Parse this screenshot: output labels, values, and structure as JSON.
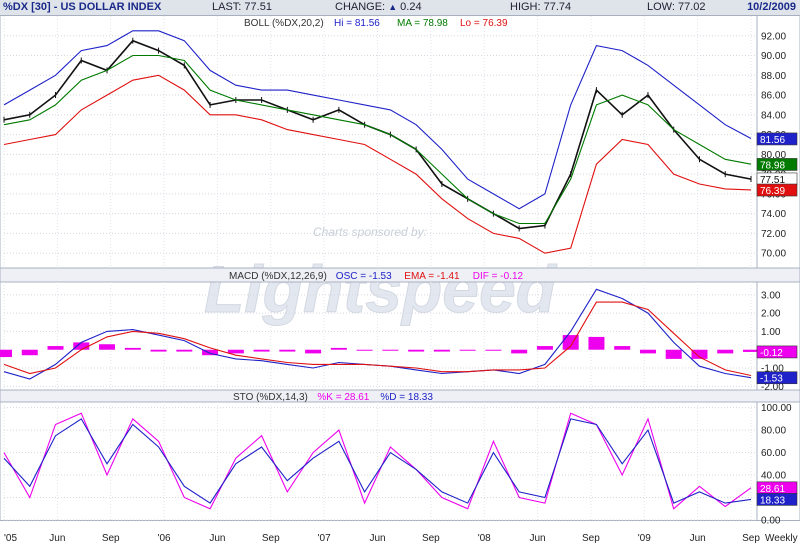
{
  "header": {
    "title": "%DX [30] - US DOLLAR INDEX",
    "last": "77.51",
    "change": "0.24",
    "high": "77.74",
    "low": "77.02",
    "date": "10/2/2009"
  },
  "watermark": {
    "sponsor": "Charts sponsored by:",
    "brand": "Lightspeed"
  },
  "colors": {
    "blue": "#1f22c8",
    "green": "#007a00",
    "red": "#e01010",
    "magenta": "#ee00ee",
    "price": "#111111"
  },
  "chart_data": [
    {
      "type": "line",
      "panel": "price",
      "title": "BOLL (%DX,20,2)",
      "legend": [
        {
          "label": "Hi = 81.56",
          "color": "#1f22c8"
        },
        {
          "label": "MA = 78.98",
          "color": "#007a00"
        },
        {
          "label": "Lo = 76.39",
          "color": "#e01010"
        }
      ],
      "ylim": [
        68.5,
        94
      ],
      "yticks": [
        "92.00",
        "90.00",
        "88.00",
        "86.00",
        "84.00",
        "82.00",
        "80.00",
        "78.00",
        "76.00",
        "74.00",
        "72.00",
        "70.00"
      ],
      "value_boxes": [
        {
          "label": "81.56",
          "value": 81.56,
          "color": "#1f22c8"
        },
        {
          "label": "78.98",
          "value": 78.98,
          "color": "#007a00"
        },
        {
          "label": "77.51",
          "value": 77.51,
          "color": "#ffffff"
        },
        {
          "label": "76.39",
          "value": 76.39,
          "color": "#e01010"
        }
      ],
      "x": [
        "2005-01",
        "2005-03",
        "2005-05",
        "2005-07",
        "2005-09",
        "2005-11",
        "2006-01",
        "2006-03",
        "2006-05",
        "2006-07",
        "2006-09",
        "2006-11",
        "2007-01",
        "2007-03",
        "2007-05",
        "2007-07",
        "2007-09",
        "2007-11",
        "2008-01",
        "2008-03",
        "2008-05",
        "2008-07",
        "2008-09",
        "2008-11",
        "2009-01",
        "2009-03",
        "2009-05",
        "2009-07",
        "2009-09",
        "2009-10"
      ],
      "series": [
        {
          "role": "price",
          "values": [
            83.5,
            84.0,
            86.0,
            89.5,
            88.5,
            91.5,
            90.5,
            89.0,
            85.0,
            85.5,
            85.5,
            84.5,
            83.5,
            84.5,
            83.0,
            82.0,
            80.5,
            77.0,
            75.5,
            74.0,
            72.5,
            72.8,
            78.0,
            86.5,
            84.0,
            86.0,
            82.5,
            79.5,
            78.0,
            77.5
          ]
        },
        {
          "role": "upper",
          "values": [
            85.0,
            86.5,
            88.0,
            90.5,
            91.0,
            92.5,
            92.5,
            91.5,
            88.5,
            87.0,
            86.5,
            86.5,
            86.0,
            85.5,
            85.0,
            84.5,
            83.0,
            80.5,
            77.5,
            76.0,
            74.5,
            76.0,
            85.0,
            91.0,
            90.5,
            89.0,
            87.0,
            85.0,
            83.0,
            81.6
          ]
        },
        {
          "role": "ma",
          "values": [
            83.0,
            83.5,
            85.0,
            87.5,
            88.5,
            90.0,
            90.0,
            89.5,
            86.5,
            85.5,
            85.0,
            84.5,
            84.0,
            83.5,
            83.0,
            82.0,
            80.5,
            78.0,
            75.5,
            74.0,
            73.0,
            73.0,
            77.5,
            85.0,
            86.0,
            85.0,
            82.5,
            81.0,
            79.5,
            79.0
          ]
        },
        {
          "role": "lower",
          "values": [
            81.0,
            81.5,
            82.0,
            84.5,
            86.0,
            87.5,
            88.0,
            86.5,
            84.0,
            84.0,
            83.5,
            82.5,
            82.0,
            81.5,
            81.0,
            79.5,
            78.0,
            75.5,
            73.5,
            72.0,
            71.5,
            70.0,
            70.5,
            79.0,
            81.5,
            81.0,
            78.0,
            77.0,
            76.5,
            76.4
          ]
        }
      ]
    },
    {
      "type": "line",
      "panel": "macd",
      "title": "MACD (%DX,12,26,9)",
      "legend": [
        {
          "label": "OSC = -1.53",
          "color": "#1f22c8"
        },
        {
          "label": "EMA = -1.41",
          "color": "#e01010"
        },
        {
          "label": "DIF = -0.12",
          "color": "#ee00ee"
        }
      ],
      "ylim": [
        -2.2,
        3.7
      ],
      "yticks": [
        "3.00",
        "2.00",
        "1.00",
        "-1.00",
        "-2.00"
      ],
      "value_boxes": [
        {
          "label": "-0.12",
          "value": -0.12,
          "color": "#ee00ee"
        },
        {
          "label": "-1.53",
          "value": -1.53,
          "color": "#1f22c8"
        }
      ],
      "series": [
        {
          "role": "osc",
          "values": [
            -1.2,
            -1.6,
            -0.8,
            0.4,
            1.0,
            1.1,
            0.8,
            0.5,
            -0.2,
            -0.5,
            -0.6,
            -0.8,
            -1.0,
            -0.7,
            -0.8,
            -0.9,
            -1.1,
            -1.3,
            -1.2,
            -1.1,
            -1.3,
            -0.8,
            1.0,
            3.3,
            2.8,
            2.0,
            0.4,
            -0.9,
            -1.3,
            -1.53
          ]
        },
        {
          "role": "ema",
          "values": [
            -0.8,
            -1.3,
            -1.0,
            0.0,
            0.7,
            1.0,
            0.9,
            0.6,
            0.1,
            -0.3,
            -0.5,
            -0.7,
            -0.8,
            -0.8,
            -0.8,
            -0.9,
            -1.0,
            -1.2,
            -1.2,
            -1.1,
            -1.1,
            -1.0,
            0.2,
            2.6,
            2.6,
            2.2,
            0.9,
            -0.4,
            -1.1,
            -1.41
          ]
        },
        {
          "role": "dif",
          "values": [
            -0.4,
            -0.3,
            0.2,
            0.4,
            0.3,
            0.1,
            -0.1,
            -0.1,
            -0.3,
            -0.2,
            -0.1,
            -0.1,
            -0.2,
            0.1,
            0.0,
            0.0,
            -0.1,
            -0.1,
            0.0,
            0.0,
            -0.2,
            0.2,
            0.8,
            0.7,
            0.2,
            -0.2,
            -0.5,
            -0.5,
            -0.2,
            -0.12
          ]
        }
      ]
    },
    {
      "type": "line",
      "panel": "sto",
      "title": "STO (%DX,14,3)",
      "legend": [
        {
          "label": "%K = 28.61",
          "color": "#ee00ee"
        },
        {
          "label": "%D = 18.33",
          "color": "#1f22c8"
        }
      ],
      "ylim": [
        0,
        105
      ],
      "yticks": [
        "100.00",
        "80.00",
        "60.00",
        "40.00",
        "20.00",
        "0.00"
      ],
      "value_boxes": [
        {
          "label": "28.61",
          "value": 28.61,
          "color": "#ee00ee"
        },
        {
          "label": "18.33",
          "value": 18.33,
          "color": "#1f22c8"
        }
      ],
      "series": [
        {
          "role": "k",
          "values": [
            60,
            20,
            85,
            95,
            40,
            90,
            70,
            20,
            10,
            55,
            75,
            25,
            60,
            80,
            15,
            65,
            45,
            20,
            10,
            70,
            20,
            15,
            95,
            85,
            40,
            90,
            10,
            30,
            12,
            28.61
          ]
        },
        {
          "role": "d",
          "values": [
            55,
            30,
            75,
            90,
            50,
            85,
            65,
            30,
            15,
            50,
            65,
            35,
            55,
            70,
            25,
            60,
            45,
            25,
            15,
            60,
            25,
            20,
            90,
            85,
            50,
            80,
            15,
            25,
            15,
            18.33
          ]
        }
      ]
    }
  ],
  "x_axis": {
    "ticks": [
      "'05",
      "Jun",
      "Sep",
      "'06",
      "Jun",
      "Sep",
      "'07",
      "Jun",
      "Sep",
      "'08",
      "Jun",
      "Sep",
      "'09",
      "Jun",
      "Sep"
    ],
    "period": "Weekly"
  }
}
